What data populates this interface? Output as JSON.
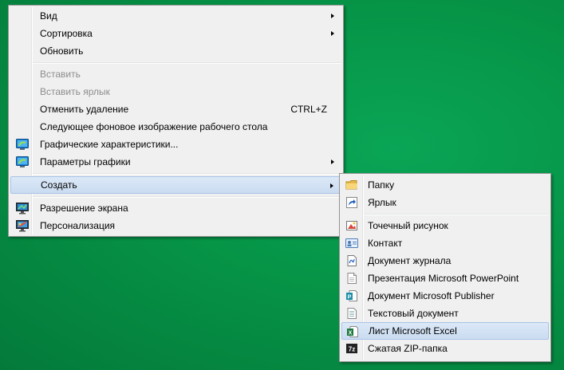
{
  "context_menu": {
    "items": [
      {
        "label": "Вид"
      },
      {
        "label": "Сортировка"
      },
      {
        "label": "Обновить"
      },
      {
        "label": "Вставить"
      },
      {
        "label": "Вставить ярлык"
      },
      {
        "label": "Отменить удаление",
        "shortcut": "CTRL+Z"
      },
      {
        "label": "Следующее фоновое изображение рабочего стола"
      },
      {
        "label": "Графические характеристики...",
        "icon": "intel-graphics-icon"
      },
      {
        "label": "Параметры графики",
        "icon": "intel-graphics-icon"
      },
      {
        "label": "Создать"
      },
      {
        "label": "Разрешение экрана",
        "icon": "display-resolution-icon"
      },
      {
        "label": "Персонализация",
        "icon": "personalization-icon"
      }
    ]
  },
  "create_submenu": {
    "items": [
      {
        "label": "Папку",
        "icon": "folder-icon"
      },
      {
        "label": "Ярлык",
        "icon": "shortcut-icon"
      },
      {
        "label": "Точечный рисунок",
        "icon": "bitmap-icon"
      },
      {
        "label": "Контакт",
        "icon": "contact-icon"
      },
      {
        "label": "Документ журнала",
        "icon": "journal-icon"
      },
      {
        "label": "Презентация Microsoft PowerPoint",
        "icon": "document-icon"
      },
      {
        "label": "Документ Microsoft Publisher",
        "icon": "publisher-icon"
      },
      {
        "label": "Текстовый документ",
        "icon": "text-document-icon"
      },
      {
        "label": "Лист Microsoft Excel",
        "icon": "excel-icon"
      },
      {
        "label": "Сжатая ZIP-папка",
        "icon": "zip-folder-icon"
      }
    ]
  },
  "colors": {
    "desktop": "#069447",
    "menu_background": "#f0f0f0",
    "highlight": "#cbdcf1",
    "highlight_border": "#a8c3e6",
    "disabled_text": "#8d8d8d"
  }
}
